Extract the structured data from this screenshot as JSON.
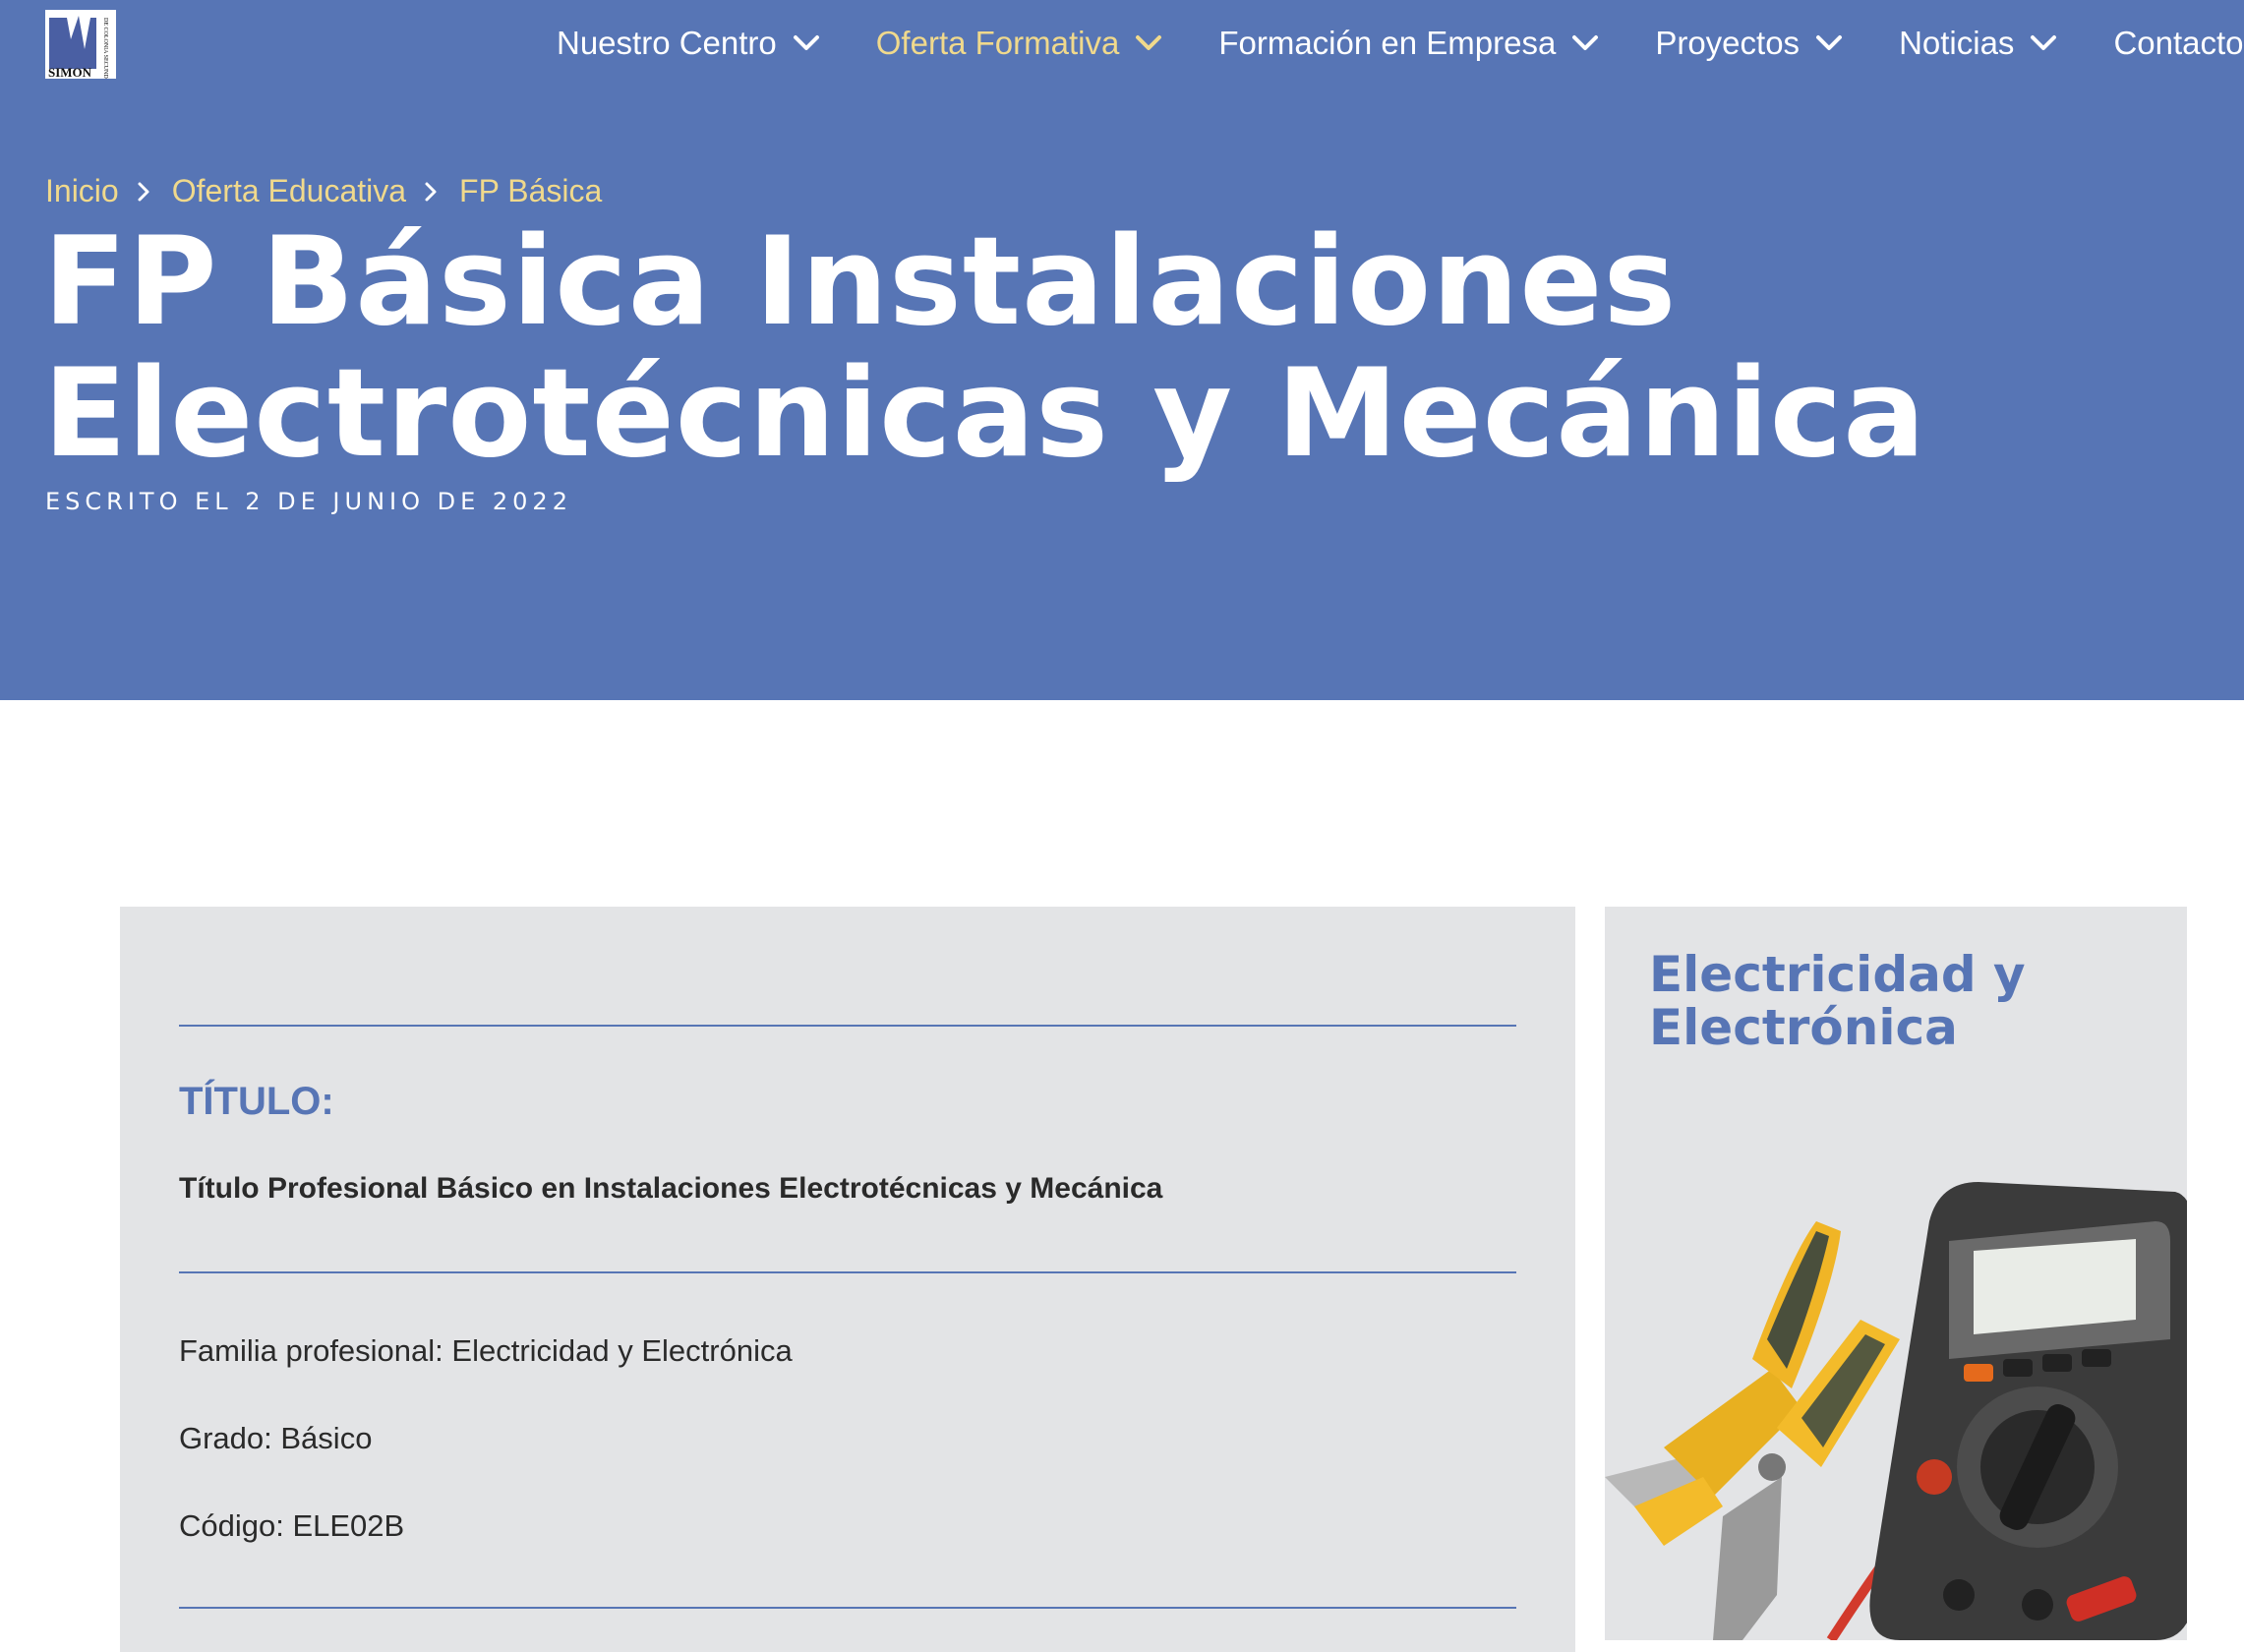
{
  "logo": {
    "text": "SIMON",
    "caption": "DE COLONIA SECUNDARIA"
  },
  "nav": {
    "items": [
      {
        "label": "Nuestro Centro",
        "active": false
      },
      {
        "label": "Oferta Formativa",
        "active": true
      },
      {
        "label": "Formación en Empresa",
        "active": false
      },
      {
        "label": "Proyectos",
        "active": false
      },
      {
        "label": "Noticias",
        "active": false
      },
      {
        "label": "Contacto",
        "active": false
      }
    ]
  },
  "breadcrumb": {
    "items": [
      "Inicio",
      "Oferta Educativa",
      "FP Básica"
    ]
  },
  "page": {
    "title": "FP Básica Instalaciones Electrotécnicas y Mecánica",
    "byline": "Escrito el 2 de junio de 2022"
  },
  "card": {
    "heading": "TÍTULO:",
    "subtitle": "Título Profesional Básico en Instalaciones Electrotécnicas y Mecánica",
    "family": "Familia profesional: Electricidad y Electrónica",
    "grade": "Grado: Básico",
    "code": "Código: ELE02B"
  },
  "sidebar": {
    "title": "Electricidad y Electrónica"
  },
  "colors": {
    "primary": "#5775b5",
    "accent": "#f0d98c",
    "card_bg": "#e3e4e6"
  }
}
